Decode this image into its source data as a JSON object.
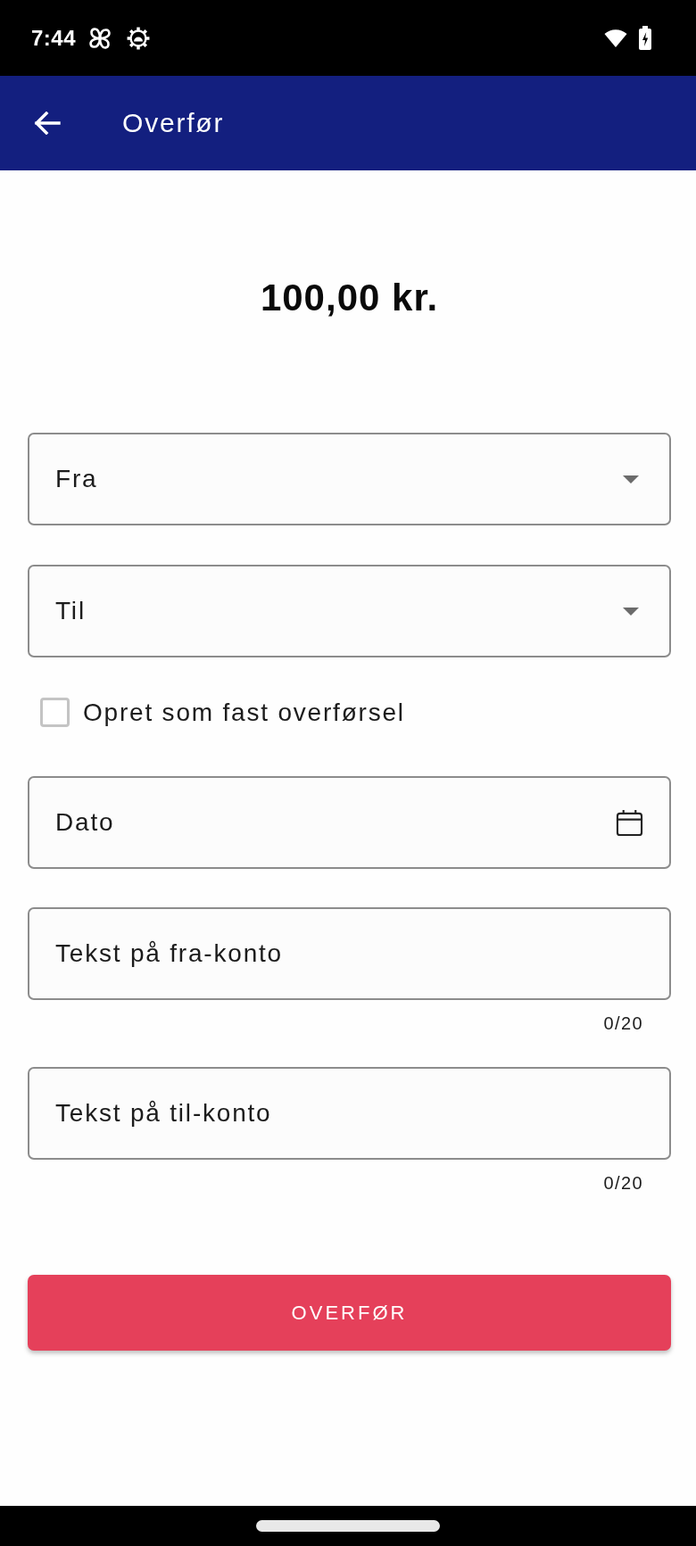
{
  "status_bar": {
    "time": "7:44"
  },
  "app_bar": {
    "title": "Overfør"
  },
  "amount": "100,00 kr.",
  "fields": [
    {
      "kind": "dropdown",
      "label": "Fra"
    },
    {
      "kind": "dropdown",
      "label": "Til"
    },
    {
      "kind": "checkbox",
      "label": "Opret som fast overførsel",
      "checked": false
    },
    {
      "kind": "date",
      "label": "Dato"
    },
    {
      "kind": "text",
      "placeholder": "Tekst på fra-konto",
      "counter": "0/20"
    },
    {
      "kind": "text",
      "placeholder": "Tekst på til-konto",
      "counter": "0/20"
    }
  ],
  "submit_button": {
    "label": "OVERFØR"
  }
}
